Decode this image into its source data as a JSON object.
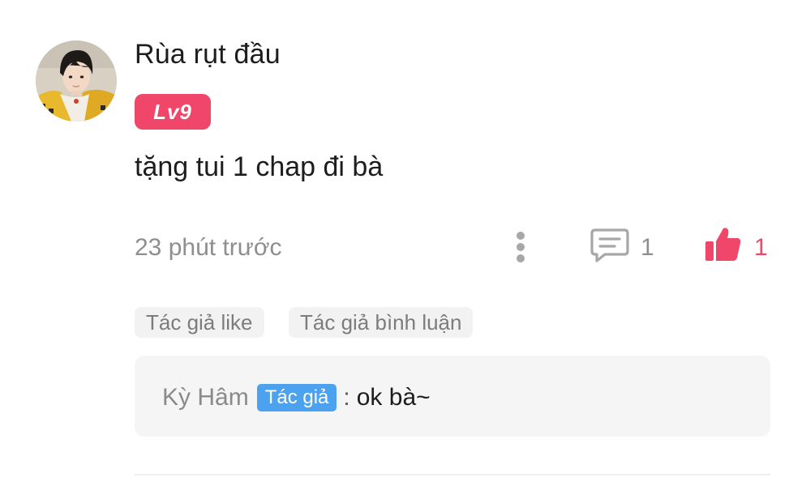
{
  "comment": {
    "user": {
      "name": "Rùa rụt đầu",
      "level": "Lv9",
      "avatar": "user-avatar-photo"
    },
    "text": "tặng tui 1 chap đi bà",
    "timestamp": "23 phút trước",
    "actions": {
      "more_icon": "more-vertical-icon",
      "reply_icon": "comment-bubble-icon",
      "reply_count": "1",
      "like_icon": "thumbs-up-icon",
      "like_count": "1"
    },
    "author_tags": [
      "Tác giả like",
      "Tác giả bình luận"
    ],
    "replies": [
      {
        "author": "Kỳ Hâm",
        "badge": "Tác giả",
        "separator": ":",
        "text": "ok bà~"
      }
    ]
  },
  "colors": {
    "accent_pink": "#f0466a",
    "author_badge_blue": "#4ca2ef",
    "muted_text": "#8e8e8e",
    "reply_background": "#f5f5f5",
    "tag_background": "#f2f2f2"
  }
}
